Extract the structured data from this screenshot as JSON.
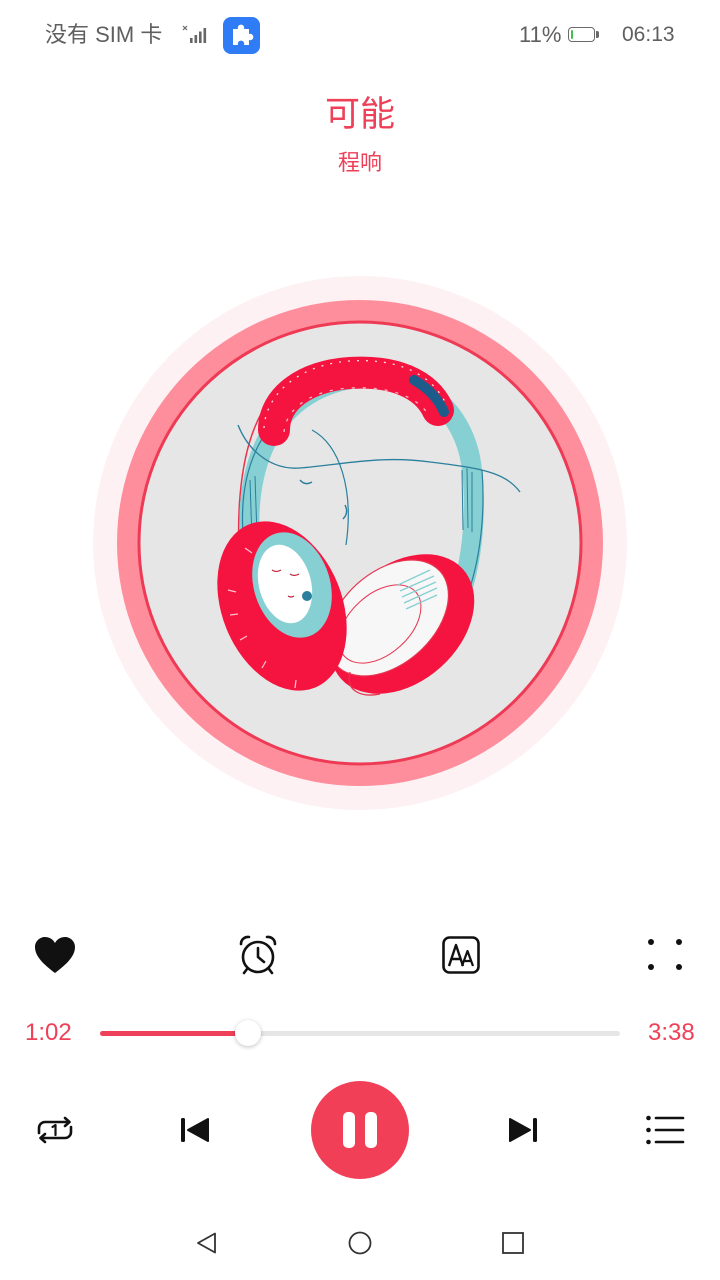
{
  "status_bar": {
    "carrier": "没有 SIM 卡",
    "battery_percent": "11%",
    "battery_level": 0.11,
    "time": "06:13",
    "signal_icon": "signal-icon",
    "app_icon": "puzzle-icon"
  },
  "song": {
    "title": "可能",
    "artist": "程响",
    "cover_art": "headphones-illustration"
  },
  "actions": [
    {
      "name": "favorite",
      "icon": "heart-icon"
    },
    {
      "name": "sleep-timer",
      "icon": "alarm-clock-icon"
    },
    {
      "name": "lyrics-font",
      "icon": "text-size-icon"
    },
    {
      "name": "more",
      "icon": "more-dots-icon"
    }
  ],
  "player": {
    "elapsed": "1:02",
    "duration": "3:38",
    "progress": 0.284,
    "state": "playing"
  },
  "controls": [
    {
      "name": "repeat-one",
      "icon": "repeat-one-icon"
    },
    {
      "name": "previous",
      "icon": "skip-previous-icon"
    },
    {
      "name": "pause",
      "icon": "pause-icon"
    },
    {
      "name": "next",
      "icon": "skip-next-icon"
    },
    {
      "name": "playlist",
      "icon": "playlist-icon"
    }
  ],
  "nav_bar": {
    "back": "back-triangle-icon",
    "home": "home-circle-icon",
    "recents": "recents-square-icon"
  },
  "colors": {
    "accent": "#ee4058",
    "pause_button": "#f13f57",
    "ring": "#fe8e9c",
    "ring_glow": "#fdf1f3",
    "battery": "#3cc24a",
    "app_icon": "#2f7cf6"
  }
}
